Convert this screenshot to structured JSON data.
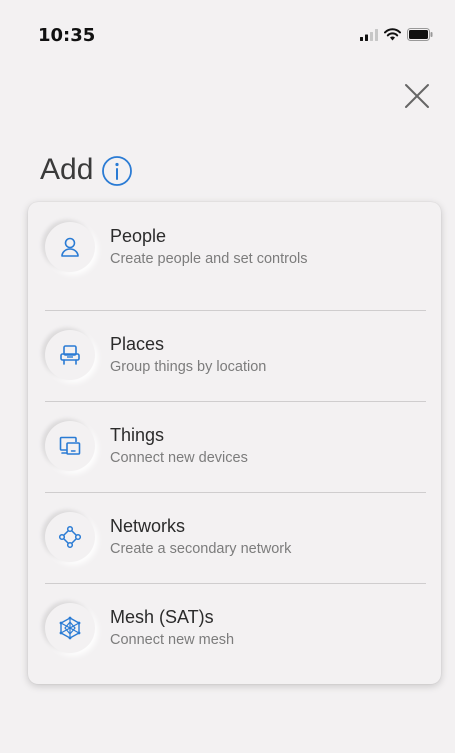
{
  "status_bar": {
    "time": "10:35",
    "icons": [
      "signal-icon",
      "wifi-icon",
      "battery-icon"
    ]
  },
  "header": {
    "close_icon": "close-icon",
    "title": "Add",
    "info_icon": "info-icon"
  },
  "colors": {
    "accent": "#2a7bd4",
    "background": "#f3f1f2",
    "title_text": "#3a3a3a",
    "subtitle_text": "#7c7c7c"
  },
  "menu": {
    "items": [
      {
        "icon": "person-icon",
        "title": "People",
        "subtitle": "Create people and set controls"
      },
      {
        "icon": "chair-icon",
        "title": "Places",
        "subtitle": "Group things by location"
      },
      {
        "icon": "devices-icon",
        "title": "Things",
        "subtitle": "Connect new devices"
      },
      {
        "icon": "network-icon",
        "title": "Networks",
        "subtitle": "Create a secondary network"
      },
      {
        "icon": "mesh-icon",
        "title": "Mesh (SAT)s",
        "subtitle": "Connect new mesh"
      }
    ]
  }
}
